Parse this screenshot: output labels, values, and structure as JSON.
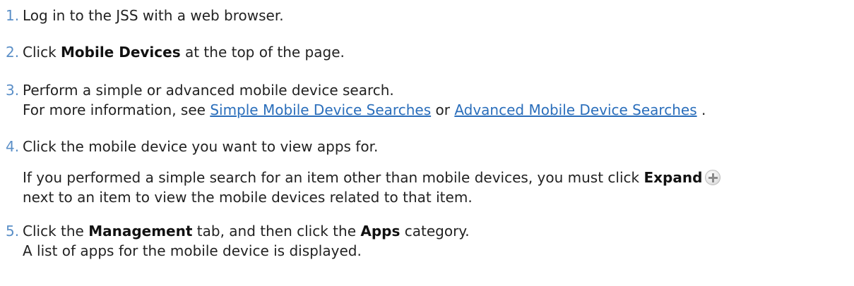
{
  "steps": [
    {
      "number": "1.",
      "line1": "Log in to the JSS with a web browser."
    },
    {
      "number": "2.",
      "before": "Click ",
      "bold": "Mobile Devices",
      "after": " at the top of the page."
    },
    {
      "number": "3.",
      "line1": "Perform a simple or advanced mobile device search.",
      "line2_before": "For more information, see ",
      "link1": "Simple Mobile Device Searches",
      "line2_mid": " or ",
      "link2": "Advanced Mobile Device Searches",
      "line2_after": " ."
    },
    {
      "number": "4.",
      "line1": "Click the mobile device you want to view apps for.",
      "note_before": "If you performed a simple search for an item other than mobile devices, you must click ",
      "note_bold": "Expand",
      "note_icon": "plus-circle-icon",
      "note_line2": "next to an item to view the mobile devices related to that item."
    },
    {
      "number": "5.",
      "before": "Click the ",
      "bold1": "Management",
      "mid": " tab, and then click the ",
      "bold2": "Apps",
      "after": " category.",
      "line2": "A list of apps for the mobile device is displayed."
    }
  ]
}
